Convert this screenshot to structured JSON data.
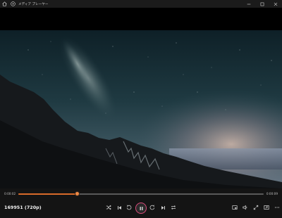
{
  "window": {
    "title": "メディア プレーヤー"
  },
  "player": {
    "current_time": "0:00:02",
    "duration": "0:00:09",
    "progress": 0.24,
    "media_title": "169951 (720p)"
  },
  "colors": {
    "accent": "#d96b2a",
    "play_ring": "#d94a7a",
    "titlebar_bg": "#1b1b1b",
    "controls_bg": "#141414"
  },
  "icons": {
    "titlebar": [
      "home-icon",
      "app-logo-icon",
      "minimize-icon",
      "maximize-icon",
      "close-icon"
    ],
    "controls": [
      "shuffle-icon",
      "previous-icon",
      "skip-back-icon",
      "pause-icon",
      "skip-forward-icon",
      "next-icon",
      "repeat-icon",
      "miniplayer-icon",
      "volume-icon",
      "fullscreen-icon",
      "cast-icon",
      "more-options-icon"
    ]
  }
}
